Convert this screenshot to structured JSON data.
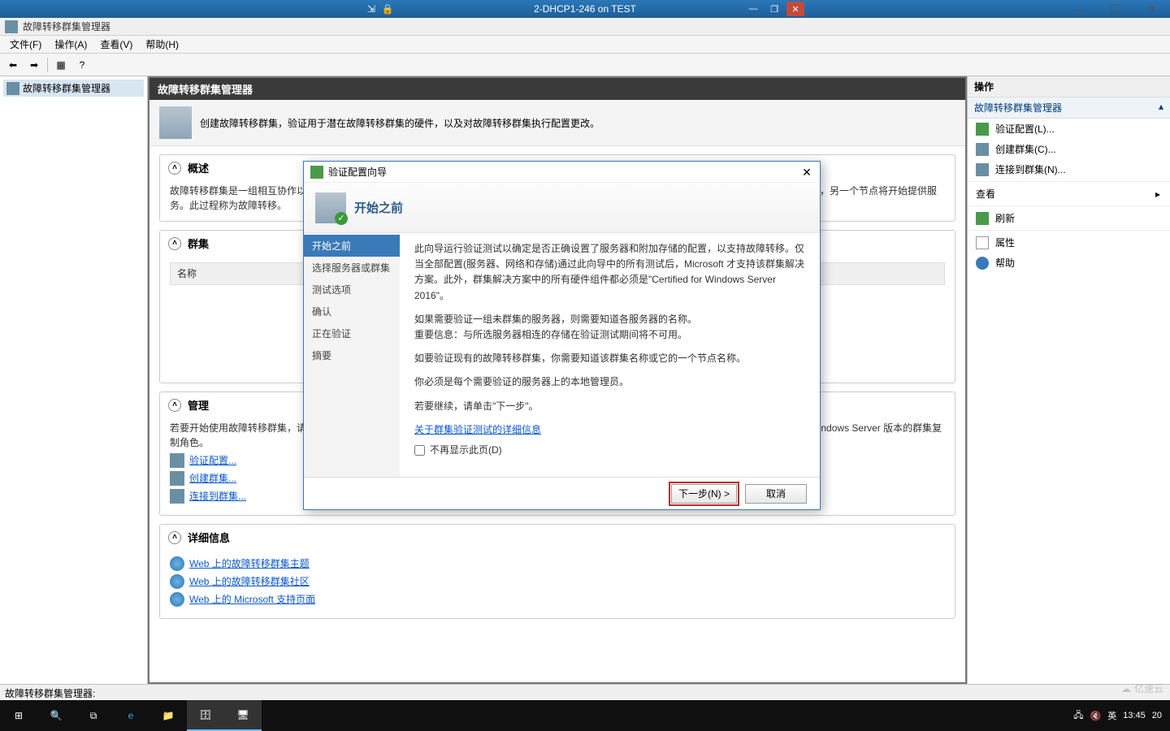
{
  "vm": {
    "title": "2-DHCP1-246 on TEST"
  },
  "app": {
    "title": "故障转移群集管理器"
  },
  "menu": {
    "file": "文件(F)",
    "action": "操作(A)",
    "view": "查看(V)",
    "help": "帮助(H)"
  },
  "tree": {
    "root": "故障转移群集管理器"
  },
  "center": {
    "header": "故障转移群集管理器",
    "intro": "创建故障转移群集，验证用于潜在故障转移群集的硬件，以及对故障转移群集执行配置更改。",
    "overview_h": "概述",
    "overview_b": "故障转移群集是一组相互协作以增加服务器角色可用性的独立计算机。群集服务器(称为节点)通过物理电缆和软件相互连接。如果群集节点之一出现故障，另一个节点将开始提供服务。此过程称为故障转移。",
    "clusters_h": "群集",
    "col_name": "名称",
    "mgmt_h": "管理",
    "mgmt_b1": "若要开始使用故障转移群集，请首先验证硬件配置，然后创建群集。完成这些步骤后，可以管理群集。从运行 Windows Server 2016 或受支持的早期 Windows Server 版本的群集复制角色。",
    "mgmt_links": [
      "验证配置...",
      "创建群集...",
      "连接到群集..."
    ],
    "details_h": "详细信息",
    "details_links": [
      "Web 上的故障转移群集主题",
      "Web 上的故障转移群集社区",
      "Web 上的 Microsoft 支持页面"
    ]
  },
  "actions": {
    "header": "操作",
    "sub": "故障转移群集管理器",
    "items": [
      {
        "label": "验证配置(L)...",
        "ic": "green"
      },
      {
        "label": "创建群集(C)...",
        "ic": "srv"
      },
      {
        "label": "连接到群集(N)...",
        "ic": "srv"
      }
    ],
    "view": "查看",
    "refresh": "刷新",
    "props": "属性",
    "help": "帮助"
  },
  "wizard": {
    "title": "验证配置向导",
    "banner_title": "开始之前",
    "nav": [
      "开始之前",
      "选择服务器或群集",
      "测试选项",
      "确认",
      "正在验证",
      "摘要"
    ],
    "p1": "此向导运行验证测试以确定是否正确设置了服务器和附加存储的配置，以支持故障转移。仅当全部配置(服务器、网络和存储)通过此向导中的所有测试后，Microsoft 才支持该群集解决方案。此外，群集解决方案中的所有硬件组件都必须是\"Certified for Windows Server 2016\"。",
    "p2": "如果需要验证一组未群集的服务器，则需要知道各服务器的名称。",
    "p2b": "重要信息：与所选服务器相连的存储在验证测试期间将不可用。",
    "p3": "如要验证现有的故障转移群集，你需要知道该群集名称或它的一个节点名称。",
    "p4": "你必须是每个需要验证的服务器上的本地管理员。",
    "p5": "若要继续，请单击\"下一步\"。",
    "link": "关于群集验证测试的详细信息",
    "checkbox": "不再显示此页(D)",
    "next": "下一步(N) >",
    "cancel": "取消"
  },
  "status": "故障转移群集管理器:",
  "tray": {
    "ime": "英",
    "time": "13:45",
    "date": "20"
  },
  "watermark": "亿速云"
}
